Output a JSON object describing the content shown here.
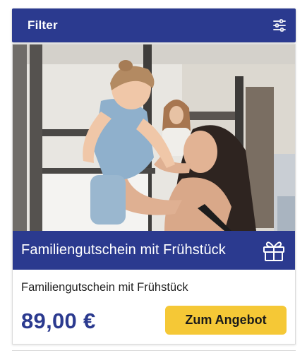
{
  "filter_bar": {
    "label": "Filter",
    "icon": "sliders-icon"
  },
  "offer_card": {
    "image": {
      "description_icon": "family-photo",
      "colors": {
        "wall": "#e8e6e1",
        "bed_frame": "#4a4846",
        "skin": "#e4b89a",
        "hair_dark": "#2e2420",
        "denim": "#8fb0cc"
      }
    },
    "banner": {
      "title": "Familiengutschein mit Frühstück",
      "icon": "gift-icon"
    },
    "subtitle": "Familiengutschein mit Frühstück",
    "price": "89,00 €",
    "cta_label": "Zum Angebot"
  },
  "colors": {
    "brand_blue": "#2b3a8f",
    "accent_yellow": "#f5c836",
    "text_dark": "#1f1f1f"
  }
}
